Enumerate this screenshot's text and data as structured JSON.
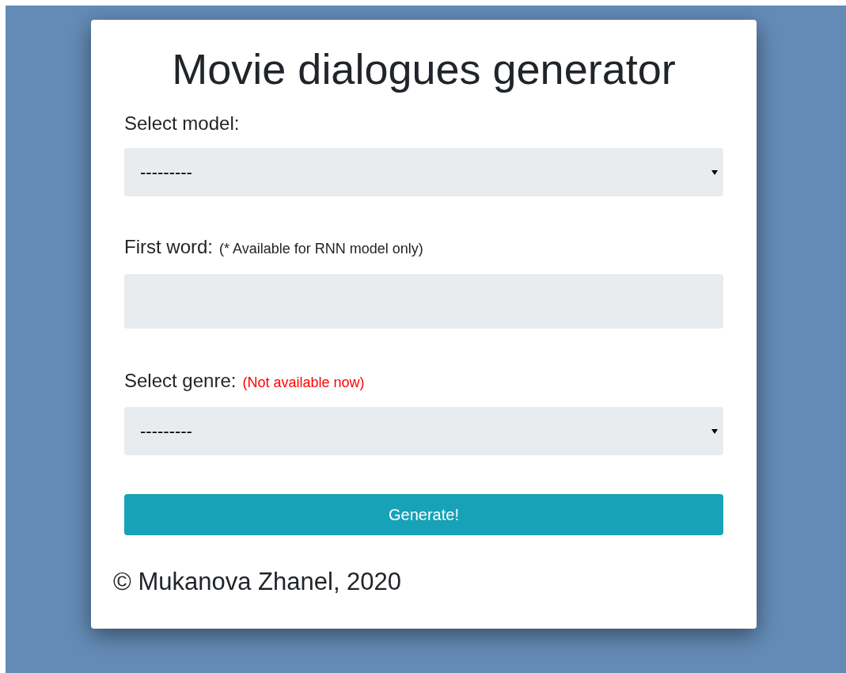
{
  "title": "Movie dialogues generator",
  "fields": [
    {
      "kind": "select",
      "label": "Select model:",
      "value": "---------"
    },
    {
      "kind": "text",
      "label": "First word:",
      "note": {
        "text": "(* Available for RNN model only)",
        "color": "#212529"
      }
    },
    {
      "kind": "select",
      "label": "Select genre:",
      "note": {
        "text": "(Not available now)",
        "color": "#ff0000"
      },
      "value": "---------"
    }
  ],
  "button": "Generate!",
  "footer": "© Mukanova Zhanel, 2020"
}
